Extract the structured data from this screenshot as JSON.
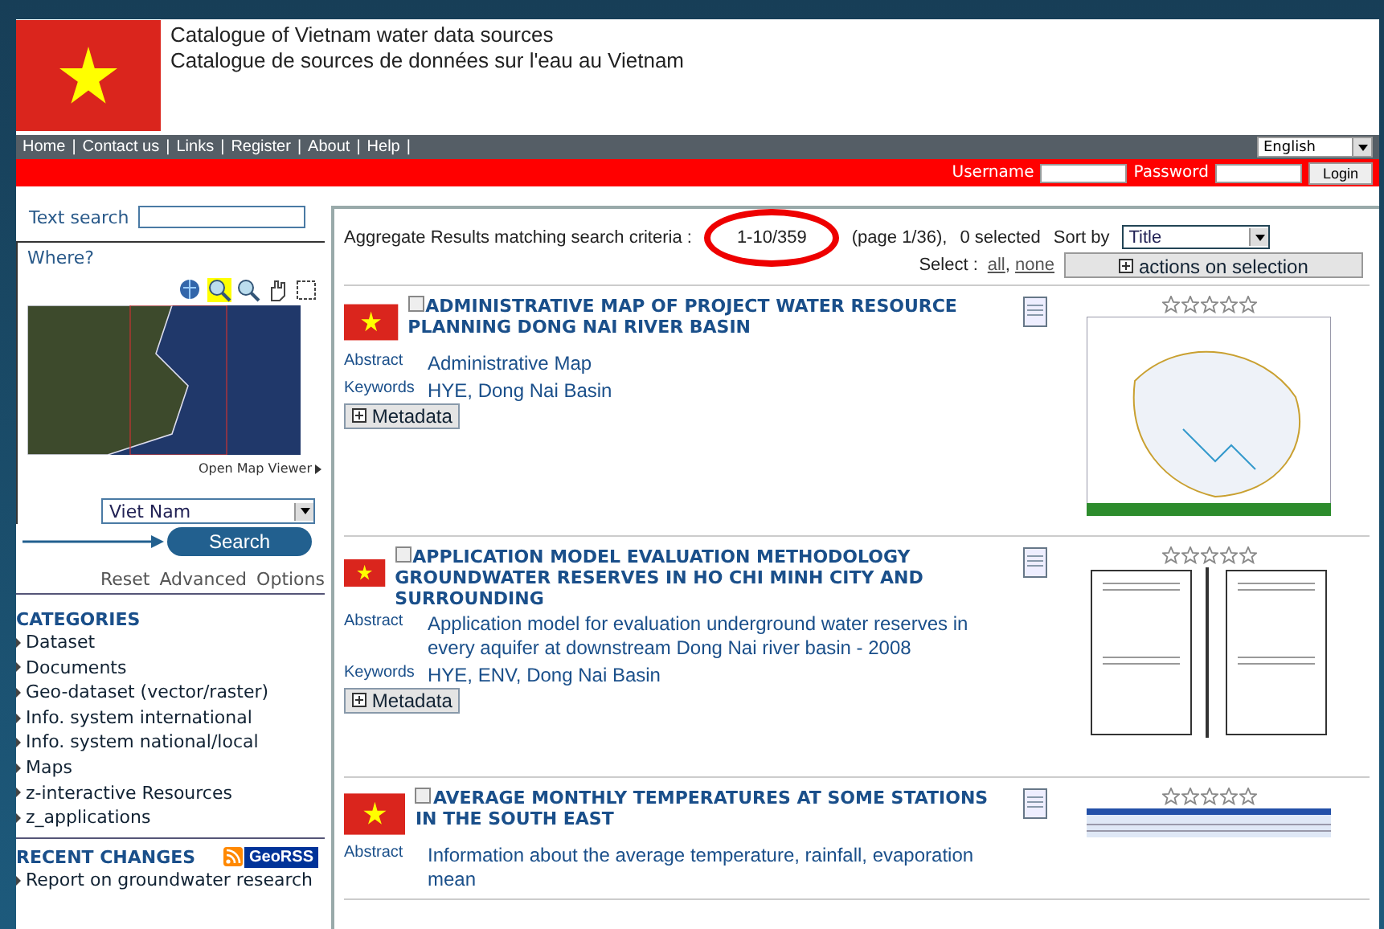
{
  "header": {
    "titles": [
      "Catalogue of Vietnam water data sources",
      "Catalogue de sources de données sur l'eau au Vietnam"
    ]
  },
  "nav": {
    "links": [
      "Home",
      "Contact us",
      "Links",
      "Register",
      "About",
      "Help"
    ],
    "separator": "|",
    "language": "English"
  },
  "login": {
    "username_label": "Username",
    "password_label": "Password",
    "button": "Login"
  },
  "sidebar": {
    "text_search_label": "Text search",
    "where_label": "Where?",
    "map_tools": [
      {
        "kind": "globe",
        "selected": false
      },
      {
        "kind": "zoomin",
        "selected": true
      },
      {
        "kind": "zoomout",
        "selected": false
      },
      {
        "kind": "hand",
        "selected": false
      },
      {
        "kind": "select",
        "selected": false
      }
    ],
    "open_map_viewer": "Open Map Viewer",
    "region": "Viet Nam",
    "search_button": "Search",
    "links": [
      "Reset",
      "Advanced",
      "Options"
    ],
    "categories_title": "CATEGORIES",
    "categories": [
      "Dataset",
      "Documents",
      "Geo-dataset (vector/raster)",
      "Info. system international",
      "Info. system national/local",
      "Maps",
      "z-interactive Resources",
      "z_applications"
    ],
    "recent_title": "RECENT CHANGES",
    "georss": "GeoRSS",
    "recent": [
      "Report on groundwater research"
    ]
  },
  "results": {
    "summary": "Aggregate Results matching search criteria :",
    "range": "1-10/359",
    "page": "(page 1/36),",
    "selected_count": "0 selected",
    "sort_label": "Sort by",
    "sort_value": "Title",
    "select_label": "Select :",
    "select_all": "all",
    "select_comma": ",",
    "select_none": "none",
    "actions": "actions on selection",
    "items": [
      {
        "title": "ADMINISTRATIVE MAP OF PROJECT WATER RESOURCE PLANNING DONG NAI RIVER BASIN",
        "checked": false,
        "stars": 0,
        "abstract_label": "Abstract",
        "abstract": "Administrative Map",
        "keywords_label": "Keywords",
        "keywords": "HYE, Dong Nai Basin",
        "kind": "map",
        "metadata": "Metadata"
      },
      {
        "title": "APPLICATION MODEL EVALUATION METHODOLOGY GROUNDWATER RESERVES IN HO CHI MINH CITY AND SURROUNDING",
        "checked": false,
        "stars": 0,
        "abstract_label": "Abstract",
        "abstract": "Application model for evaluation underground water reserves in every aquifer at downstream Dong Nai river basin - 2008",
        "keywords_label": "Keywords",
        "keywords": "HYE, ENV, Dong Nai Basin",
        "kind": "document",
        "metadata": "Metadata"
      },
      {
        "title": "AVERAGE MONTHLY TEMPERATURES AT SOME STATIONS IN THE SOUTH EAST",
        "checked": false,
        "stars": 0,
        "abstract_label": "Abstract",
        "abstract": "Information about the average temperature, rainfall, evaporation mean",
        "kind": "spreadsheet"
      }
    ]
  }
}
